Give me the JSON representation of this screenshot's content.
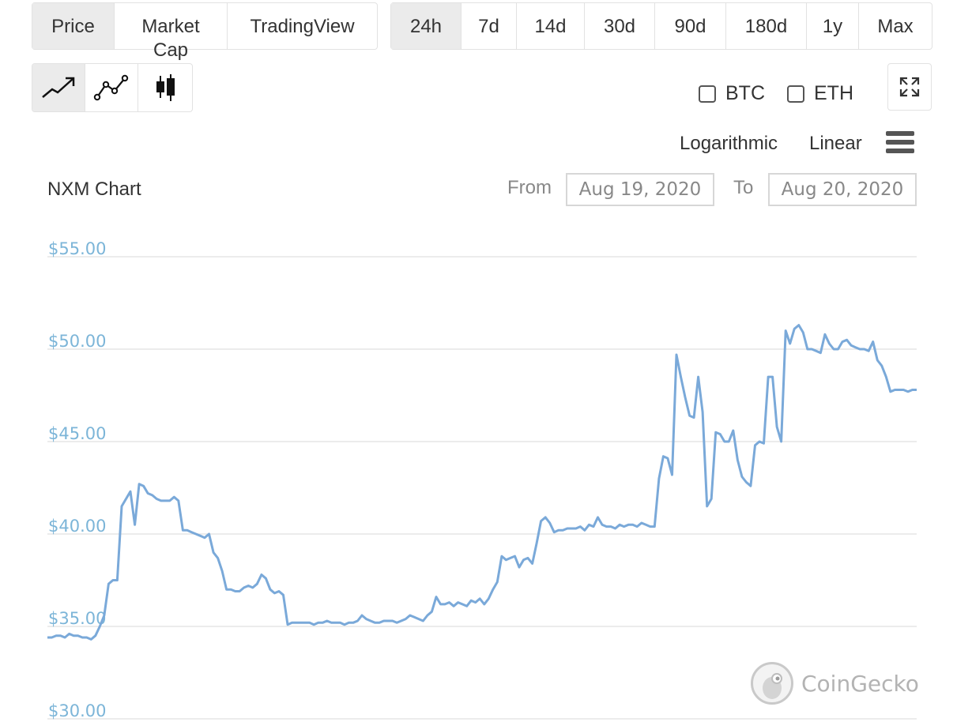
{
  "metric_tabs": [
    {
      "label": "Price",
      "active": true
    },
    {
      "label": "Market Cap",
      "active": false
    },
    {
      "label": "TradingView",
      "active": false
    }
  ],
  "range_tabs": [
    {
      "label": "24h",
      "active": true
    },
    {
      "label": "7d",
      "active": false
    },
    {
      "label": "14d",
      "active": false
    },
    {
      "label": "30d",
      "active": false
    },
    {
      "label": "90d",
      "active": false
    },
    {
      "label": "180d",
      "active": false
    },
    {
      "label": "1y",
      "active": false
    },
    {
      "label": "Max",
      "active": false
    }
  ],
  "chart_types": [
    {
      "icon": "line-chart-icon",
      "active": true
    },
    {
      "icon": "line-points-chart-icon",
      "active": false
    },
    {
      "icon": "candlestick-chart-icon",
      "active": false
    }
  ],
  "compare": {
    "btc_label": "BTC",
    "eth_label": "ETH",
    "btc_checked": false,
    "eth_checked": false
  },
  "scale": {
    "log_label": "Logarithmic",
    "linear_label": "Linear"
  },
  "date_range": {
    "from_label": "From",
    "from_value": "Aug 19, 2020",
    "to_label": "To",
    "to_value": "Aug 20, 2020"
  },
  "watermark": {
    "text": "CoinGecko"
  },
  "colors": {
    "line": "#7aa9d9",
    "axis_label": "#7cb5d8",
    "grid": "#e6e6e6",
    "active_tab": "#ebebeb"
  },
  "chart_data": {
    "type": "line",
    "title": "NXM Chart",
    "y_ticks": [
      "$55.00",
      "$50.00",
      "$45.00",
      "$40.00",
      "$35.00",
      "$30.00"
    ],
    "y_tick_values": [
      55,
      50,
      45,
      40,
      35,
      30
    ],
    "ylim": [
      30,
      55
    ],
    "x": [
      0,
      1,
      2,
      3,
      4,
      5,
      6,
      7,
      8,
      9,
      10,
      11,
      12,
      13,
      14,
      15,
      16,
      17,
      18,
      19,
      20,
      21,
      22,
      23,
      24,
      25,
      26,
      27,
      28,
      29,
      30,
      31,
      32,
      33,
      34,
      35,
      36,
      37,
      38,
      39,
      40,
      41,
      42,
      43,
      44,
      45,
      46,
      47,
      48,
      49,
      50,
      51,
      52,
      53,
      54,
      55,
      56,
      57,
      58,
      59,
      60,
      61,
      62,
      63,
      64,
      65,
      66,
      67,
      68,
      69,
      70,
      71,
      72,
      73,
      74,
      75,
      76,
      77,
      78,
      79,
      80,
      81,
      82,
      83,
      84,
      85,
      86,
      87,
      88,
      89,
      90,
      91,
      92,
      93,
      94,
      95,
      96,
      97,
      98,
      99,
      100,
      101,
      102,
      103,
      104,
      105,
      106,
      107,
      108,
      109,
      110,
      111,
      112,
      113,
      114,
      115,
      116,
      117,
      118,
      119,
      120,
      121,
      122,
      123,
      124,
      125,
      126,
      127,
      128,
      129,
      130,
      131,
      132,
      133,
      134,
      135,
      136,
      137,
      138,
      139,
      140,
      141,
      142,
      143,
      144,
      145,
      146,
      147,
      148,
      149,
      150,
      151,
      152,
      153,
      154,
      155,
      156,
      157,
      158,
      159,
      160,
      161,
      162,
      163,
      164,
      165,
      166,
      167,
      168,
      169,
      170,
      171,
      172,
      173,
      174,
      175,
      176,
      177,
      178,
      179,
      180,
      181,
      182,
      183,
      184,
      185,
      186,
      187,
      188,
      189,
      190,
      191,
      192,
      193,
      194,
      195,
      196,
      197,
      198,
      199
    ],
    "series": [
      {
        "values": [
          34.4,
          34.4,
          34.5,
          34.5,
          34.4,
          34.6,
          34.5,
          34.5,
          34.4,
          34.4,
          34.3,
          34.5,
          35.0,
          35.6,
          37.3,
          37.5,
          37.5,
          41.5,
          41.9,
          42.3,
          40.5,
          42.7,
          42.6,
          42.2,
          42.1,
          41.9,
          41.8,
          41.8,
          41.8,
          42.0,
          41.8,
          40.2,
          40.2,
          40.1,
          40.0,
          39.9,
          39.8,
          40.0,
          39.0,
          38.7,
          38.0,
          37.0,
          37.0,
          36.9,
          36.9,
          37.1,
          37.2,
          37.1,
          37.3,
          37.8,
          37.6,
          37.0,
          36.8,
          36.9,
          36.7,
          35.1,
          35.2,
          35.2,
          35.2,
          35.2,
          35.2,
          35.1,
          35.2,
          35.2,
          35.3,
          35.2,
          35.2,
          35.2,
          35.1,
          35.2,
          35.2,
          35.3,
          35.6,
          35.4,
          35.3,
          35.2,
          35.2,
          35.3,
          35.3,
          35.3,
          35.2,
          35.3,
          35.4,
          35.6,
          35.5,
          35.4,
          35.3,
          35.6,
          35.8,
          36.6,
          36.2,
          36.2,
          36.3,
          36.1,
          36.3,
          36.2,
          36.1,
          36.4,
          36.3,
          36.5,
          36.2,
          36.5,
          37.0,
          37.4,
          38.8,
          38.6,
          38.7,
          38.8,
          38.2,
          38.6,
          38.7,
          38.4,
          39.5,
          40.7,
          40.9,
          40.6,
          40.1,
          40.2,
          40.2,
          40.3,
          40.3,
          40.3,
          40.4,
          40.2,
          40.5,
          40.4,
          40.9,
          40.5,
          40.4,
          40.4,
          40.3,
          40.5,
          40.4,
          40.5,
          40.5,
          40.4,
          40.6,
          40.5,
          40.4,
          40.4,
          43.0,
          44.2,
          44.1,
          43.2,
          49.7,
          48.5,
          47.4,
          46.4,
          46.3,
          48.5,
          46.6,
          41.5,
          41.9,
          45.5,
          45.4,
          45.0,
          45.0,
          45.6,
          44.0,
          43.1,
          42.8,
          42.6,
          44.8,
          45.0,
          44.9,
          48.5,
          48.5,
          45.8,
          45.0,
          51.0,
          50.3,
          51.1,
          51.3,
          50.9,
          50.0,
          50.0,
          49.9,
          49.8,
          50.8,
          50.3,
          50.0,
          50.0,
          50.4,
          50.5,
          50.2,
          50.1,
          50.0,
          50.0,
          49.9,
          50.4,
          49.4,
          49.1,
          48.5,
          47.7,
          47.8,
          47.8,
          47.8,
          47.7,
          47.8,
          47.8,
          47.7,
          47.8
        ]
      }
    ]
  }
}
